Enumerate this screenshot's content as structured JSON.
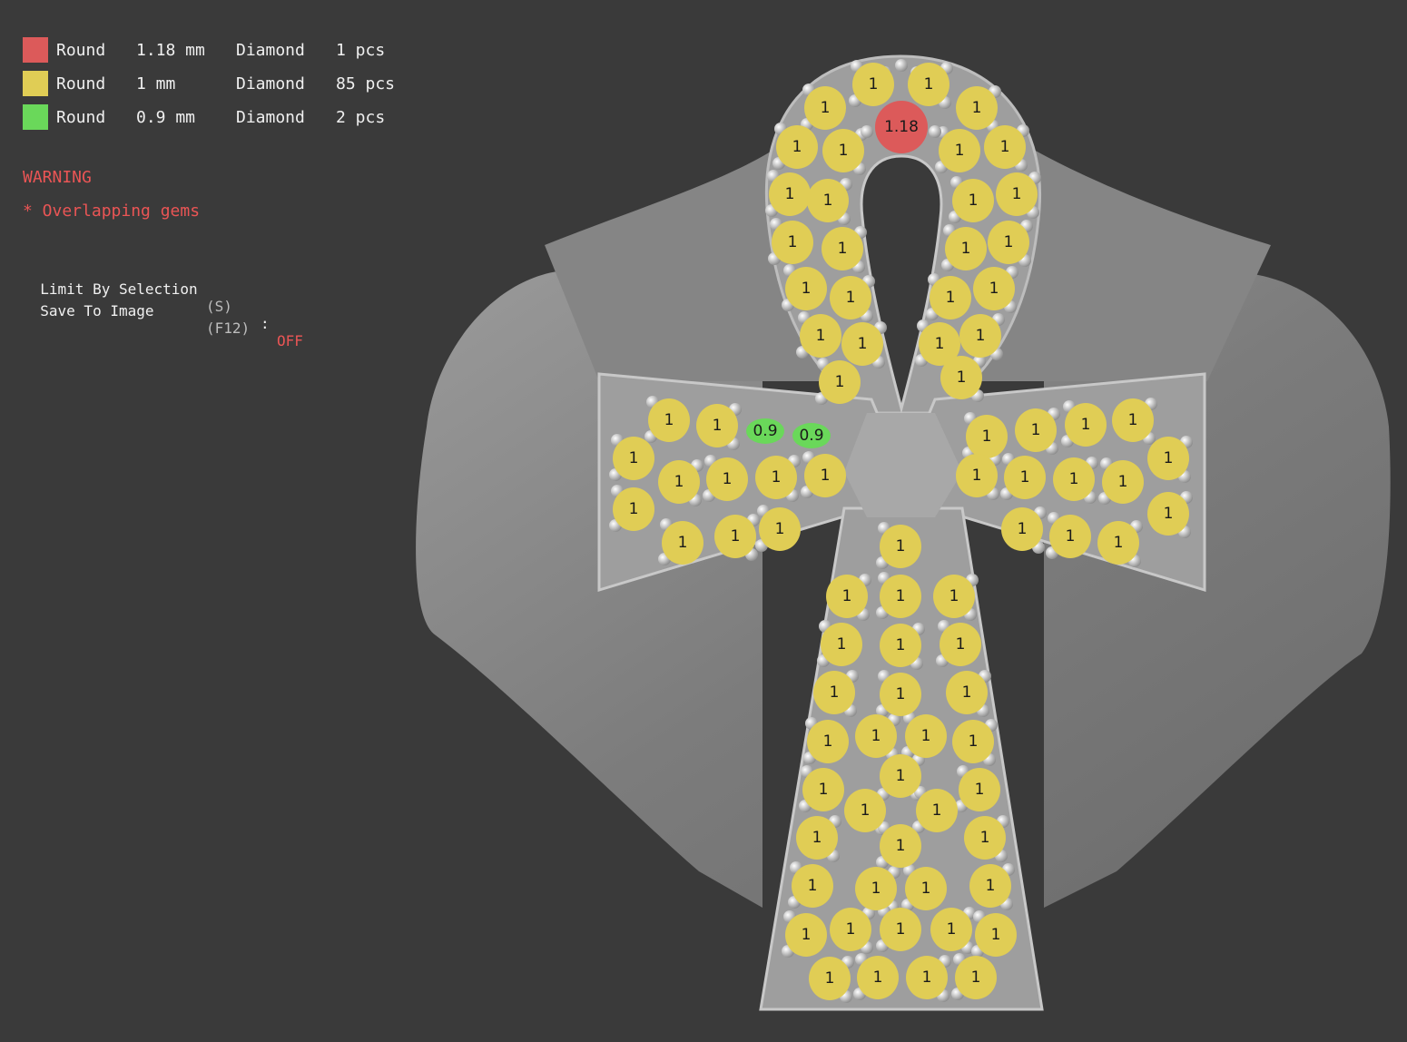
{
  "legend": [
    {
      "shape": "Round",
      "size": "1.18 mm",
      "material": "Diamond",
      "count": "1 pcs",
      "color": "#dc5a5a"
    },
    {
      "shape": "Round",
      "size": "1 mm",
      "material": "Diamond",
      "count": "85 pcs",
      "color": "#e0cd55"
    },
    {
      "shape": "Round",
      "size": "0.9 mm",
      "material": "Diamond",
      "count": "2 pcs",
      "color": "#6ad85a"
    }
  ],
  "warning": {
    "title": "WARNING",
    "message": "* Overlapping gems"
  },
  "options": {
    "limit_label": "Limit By Selection",
    "limit_key": "(S)",
    "limit_colon": ":",
    "limit_value": "OFF",
    "save_label": "Save To Image",
    "save_key": "(F12)"
  },
  "colors": {
    "background": "#3a3a3a",
    "model": "#8a8a8a",
    "warning": "#ea5555"
  },
  "gems": {
    "large": {
      "label": "1.18",
      "color": "#dc5a5a"
    },
    "medium_label": "1",
    "small_label": "0.9",
    "medium_color": "#e0cd55",
    "small_color": "#6ad85a"
  }
}
